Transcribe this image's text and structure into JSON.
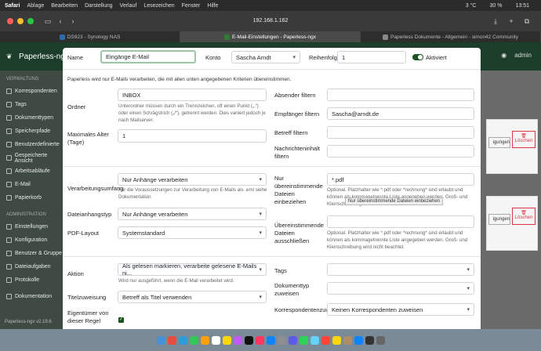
{
  "menubar": {
    "items": [
      "Safari",
      "Ablage",
      "Bearbeiten",
      "Darstellung",
      "Verlauf",
      "Lesezeichen",
      "Fenster",
      "Hilfe"
    ],
    "weather": "3 °C",
    "battery": "30 %",
    "time": "13:51"
  },
  "browser": {
    "url": "192.168.1.162",
    "tabs": [
      "DS923 - Synology NAS",
      "E-Mail-Einstellungen - Paperless-ngx",
      "Paperless Dokumente - Allgemein - simon42 Community"
    ]
  },
  "header": {
    "logo": "Paperless-ngx",
    "user": "admin"
  },
  "sidebar": {
    "section1": "VERWALTUNG",
    "items1": [
      "Korrespondenten",
      "Tags",
      "Dokumenttypen",
      "Speicherpfade",
      "Benutzerdefinierte",
      "Gespeicherte Ansicht",
      "Arbeitsabläufe",
      "E-Mail",
      "Papierkorb"
    ],
    "section2": "ADMINISTRATION",
    "items2": [
      "Einstellungen",
      "Konfiguration",
      "Benutzer & Gruppe",
      "Dateiaufgaben",
      "Protokolle"
    ],
    "doc": "Dokumentation",
    "version": "Paperless-ngx v2.19.6"
  },
  "background": {
    "btn1": "igungen",
    "btn2": "Löschen"
  },
  "form": {
    "name_label": "Name",
    "name_value": "Eingänge E-Mail",
    "account_label": "Konto",
    "account_value": "Sascha Arndt",
    "order_label": "Reihenfolge",
    "order_value": "1",
    "active_label": "Aktiviert",
    "intro": "Paperless wird nur E-Mails verarbeiten, die mit allen unten angegebenen Kriterien übereinstimmen.",
    "folder_label": "Ordner",
    "folder_value": "INBOX",
    "folder_help": "Unterordner müssen durch ein Trennzeichen, oft einen Punkt („.“) oder einen Schrägstrich („/“), getrennt werden. Dies variiert jedoch je nach Mailserver.",
    "maxage_label": "Maximales Alter (Tage)",
    "maxage_value": "1",
    "sender_label": "Absender filtern",
    "sender_value": "",
    "recipient_label": "Empfänger filtern",
    "recipient_value": "Sascha@arndt.de",
    "subject_label": "Betreff filtern",
    "body_label": "Nachrichteninhalt filtern",
    "scope_label": "Verarbeitungsumfang",
    "scope_value": "Nur Anhänge verarbeiten",
    "scope_help": "Für die Voraussetzungen zur Verarbeitung von E-Mails als .eml siehe Dokumentation",
    "attach_label": "Dateianhangstyp",
    "attach_value": "Nur Anhänge verarbeiten",
    "pdf_label": "PDF-Layout",
    "pdf_value": "Systemstandard",
    "include_label": "Nur übereinstimmende Dateien einbeziehen",
    "include_value": "*.pdf",
    "include_help": "Optional. Platzhalter wie *.pdf oder *rechnung* sind erlaubt und können als kommagetrennte Liste angegeben werden. Groß- und Kleinschreibung wird nicht beachtet.",
    "tooltip": "Nur übereinstimmende Dateien einbeziehen",
    "exclude_label": "Übereinstimmende Dateien ausschließen",
    "exclude_help": "Optional. Platzhalter wie *.pdf oder *rechnung* sind erlaubt und können als kommagetrennte Liste angegeben werden. Groß- und Kleinschreibung wird nicht beachtet.",
    "action_label": "Aktion",
    "action_value": "Als gelesen markieren, verarbeite gelesene E-Mails ni...",
    "action_help": "Wird nur ausgeführt, wenn die E-Mail verarbeitet wird.",
    "title_label": "Titelzuweisung",
    "title_value": "Betreff als Titel verwenden",
    "owner_label": "Eigentümer von dieser Regel",
    "tags_label": "Tags",
    "doctype_label": "Dokumenttyp zuweisen",
    "corr_label": "Korrespondentenzuwe",
    "corr_value": "Keinen Korrespondenten zuweisen"
  }
}
